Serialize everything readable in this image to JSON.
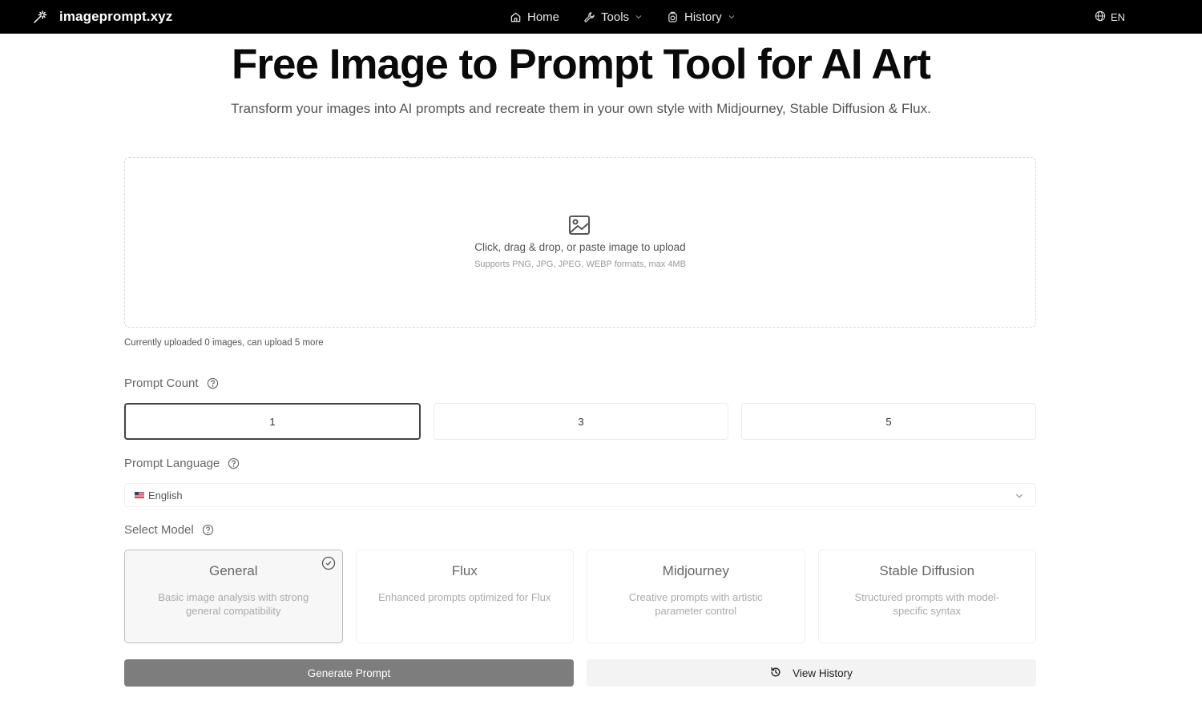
{
  "header": {
    "brand": "imageprompt.xyz",
    "nav": [
      {
        "label": "Home",
        "icon": "home-icon"
      },
      {
        "label": "Tools",
        "icon": "wrench-icon",
        "has_dropdown": true
      },
      {
        "label": "History",
        "icon": "history-icon",
        "has_dropdown": true
      }
    ],
    "language": "EN"
  },
  "hero": {
    "title": "Free Image to Prompt Tool for AI Art",
    "subtitle": "Transform your images into AI prompts and recreate them in your own style with Midjourney, Stable Diffusion & Flux."
  },
  "upload": {
    "main_text": "Click, drag & drop, or paste image to upload",
    "sub_text": "Supports PNG, JPG, JPEG, WEBP formats, max 4MB",
    "status": "Currently uploaded 0 images, can upload 5 more"
  },
  "prompt_count": {
    "label": "Prompt Count",
    "options": [
      "1",
      "3",
      "5"
    ],
    "selected": "1"
  },
  "prompt_language": {
    "label": "Prompt Language",
    "selected": "English",
    "flag": "us-flag"
  },
  "model": {
    "label": "Select Model",
    "selected": "General",
    "options": [
      {
        "name": "General",
        "desc": "Basic image analysis with strong general compatibility"
      },
      {
        "name": "Flux",
        "desc": "Enhanced prompts optimized for Flux"
      },
      {
        "name": "Midjourney",
        "desc": "Creative prompts with artistic parameter control"
      },
      {
        "name": "Stable Diffusion",
        "desc": "Structured prompts with model-specific syntax"
      }
    ]
  },
  "actions": {
    "generate": "Generate Prompt",
    "history": "View History"
  },
  "colors": {
    "header_bg": "#000000",
    "generate_bg": "#7d7d7d",
    "history_bg": "#f3f3f3"
  }
}
